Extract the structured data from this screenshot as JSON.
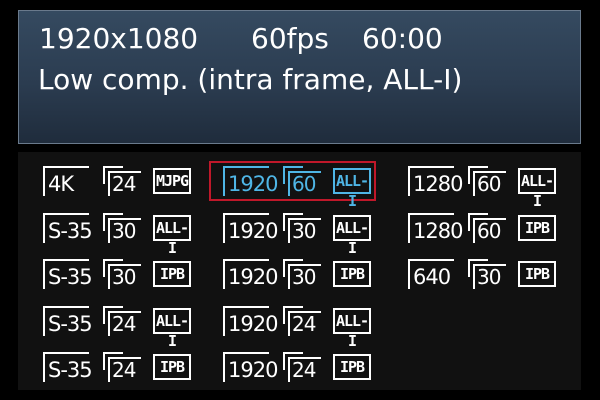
{
  "info": {
    "resolution": "1920x1080",
    "fps": "60fps",
    "duration": "60:00",
    "compression": "Low comp. (intra frame, ALL-I)"
  },
  "options": [
    {
      "res": "4K",
      "fps": "24",
      "comp": "MJPG",
      "selected": false
    },
    {
      "res": "S-35",
      "fps": "30",
      "comp": "ALL-I",
      "selected": false
    },
    {
      "res": "S-35",
      "fps": "30",
      "comp": "IPB",
      "selected": false
    },
    {
      "res": "S-35",
      "fps": "24",
      "comp": "ALL-I",
      "selected": false
    },
    {
      "res": "S-35",
      "fps": "24",
      "comp": "IPB",
      "selected": false
    },
    {
      "res": "1920",
      "fps": "60",
      "comp": "ALL-I",
      "selected": true
    },
    {
      "res": "1920",
      "fps": "30",
      "comp": "ALL-I",
      "selected": false
    },
    {
      "res": "1920",
      "fps": "30",
      "comp": "IPB",
      "selected": false
    },
    {
      "res": "1920",
      "fps": "24",
      "comp": "ALL-I",
      "selected": false
    },
    {
      "res": "1920",
      "fps": "24",
      "comp": "IPB",
      "selected": false
    },
    {
      "res": "1280",
      "fps": "60",
      "comp": "ALL-I",
      "selected": false
    },
    {
      "res": "1280",
      "fps": "60",
      "comp": "IPB",
      "selected": false
    },
    {
      "res": "640",
      "fps": "30",
      "comp": "IPB",
      "selected": false
    }
  ],
  "colors": {
    "highlight": "#4fb6e6",
    "selection_frame": "#c0182a",
    "panel": "#2f4257"
  }
}
